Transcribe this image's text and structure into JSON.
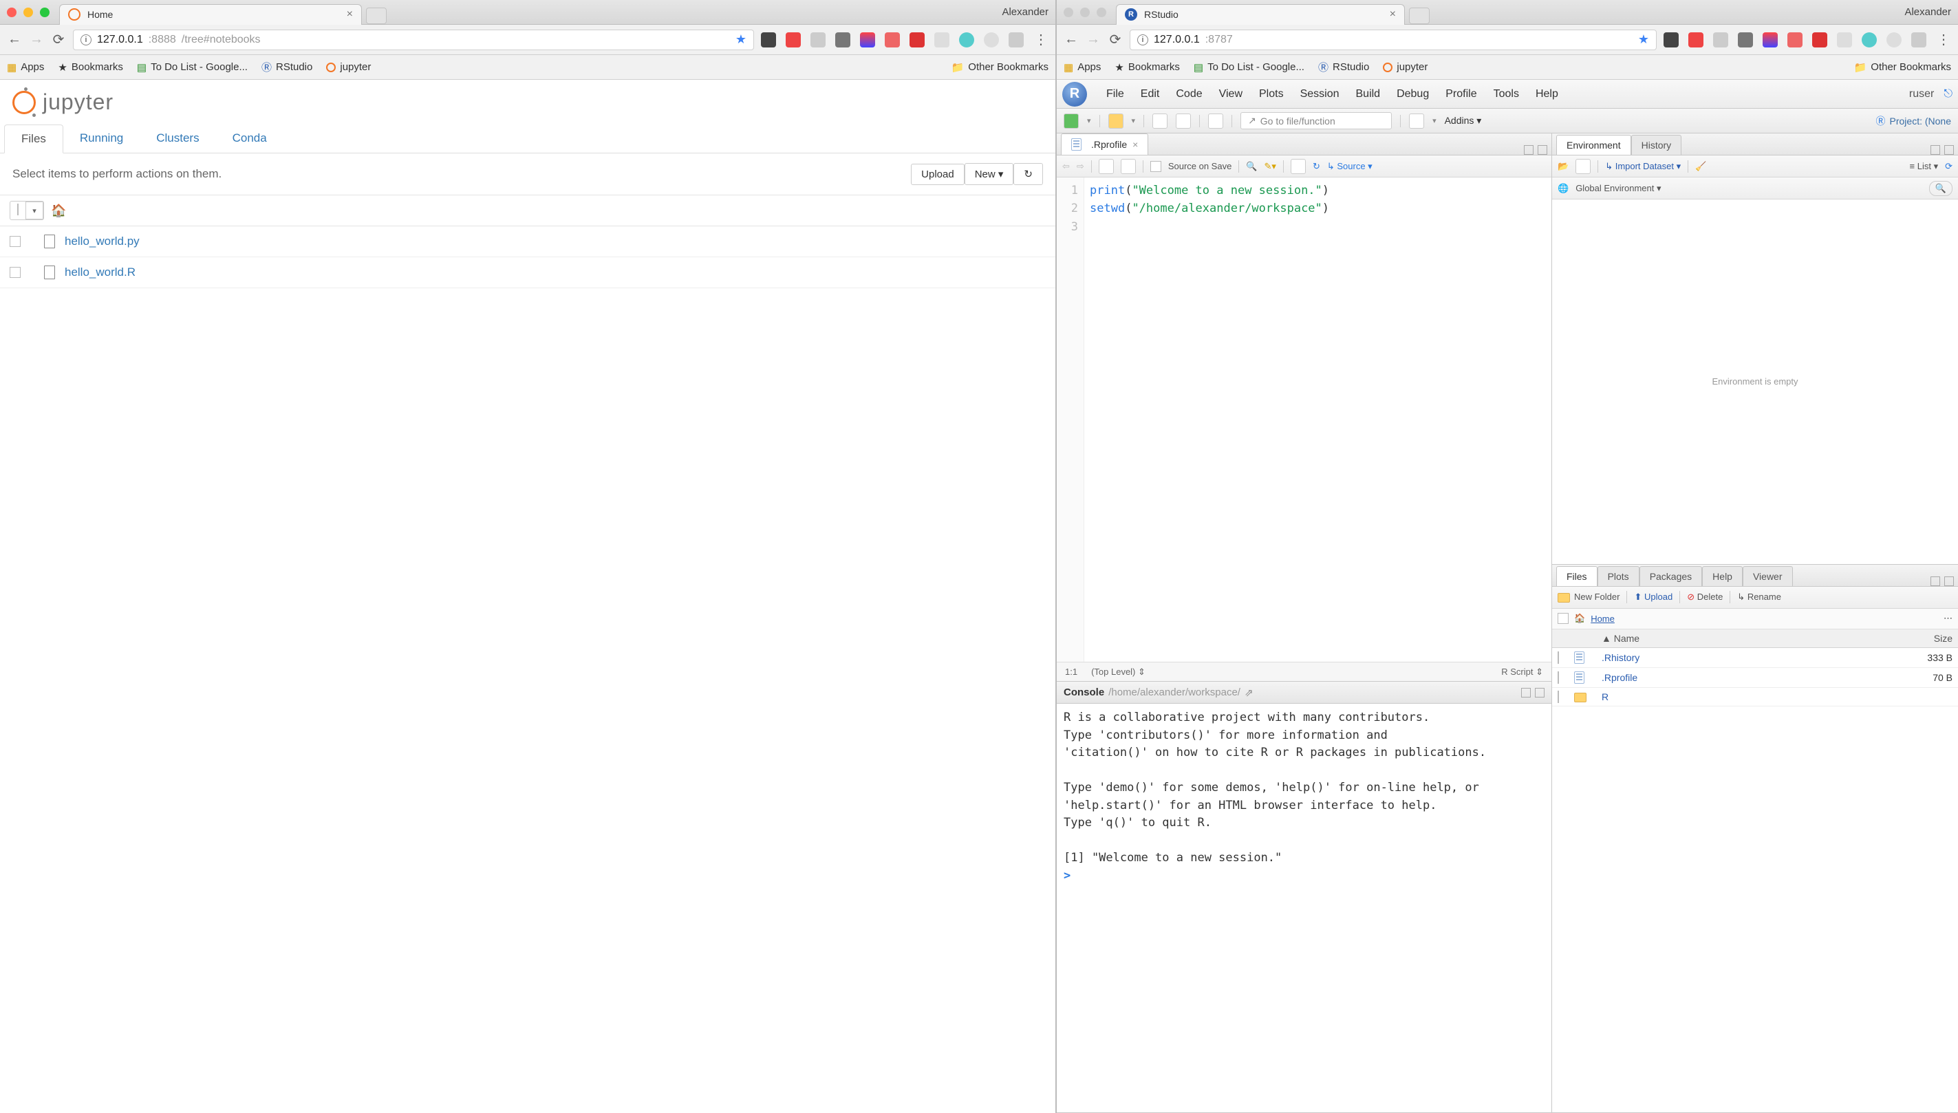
{
  "left": {
    "profile": "Alexander",
    "tab_title": "Home",
    "url_host": "127.0.0.1",
    "url_port": ":8888",
    "url_path": "/tree#notebooks",
    "bookmarks": {
      "apps": "Apps",
      "bm": "Bookmarks",
      "todo": "To Do List - Google...",
      "rstudio": "RStudio",
      "jupyter": "jupyter",
      "other": "Other Bookmarks"
    },
    "logo": "jupyter",
    "tabs": [
      "Files",
      "Running",
      "Clusters",
      "Conda"
    ],
    "hint": "Select items to perform actions on them.",
    "buttons": {
      "upload": "Upload",
      "new": "New",
      "refresh": "↻"
    },
    "files": [
      {
        "name": "hello_world.py"
      },
      {
        "name": "hello_world.R"
      }
    ]
  },
  "right": {
    "profile": "Alexander",
    "tab_title": "RStudio",
    "url_host": "127.0.0.1",
    "url_port": ":8787",
    "bookmarks": {
      "apps": "Apps",
      "bm": "Bookmarks",
      "todo": "To Do List - Google...",
      "rstudio": "RStudio",
      "jupyter": "jupyter",
      "other": "Other Bookmarks"
    },
    "menu": [
      "File",
      "Edit",
      "Code",
      "View",
      "Plots",
      "Session",
      "Build",
      "Debug",
      "Profile",
      "Tools",
      "Help"
    ],
    "user": "ruser",
    "goto_placeholder": "Go to file/function",
    "addins": "Addins",
    "project": "Project: (None",
    "source": {
      "tab": ".Rprofile",
      "on_save": "Source on Save",
      "source_btn": "Source",
      "lines": [
        "print(\"Welcome to a new session.\")",
        "setwd(\"/home/alexander/workspace\")",
        ""
      ],
      "status_pos": "1:1",
      "status_scope": "(Top Level)",
      "status_type": "R Script"
    },
    "console": {
      "title": "Console",
      "path": "/home/alexander/workspace/",
      "text": "R is a collaborative project with many contributors.\nType 'contributors()' for more information and\n'citation()' on how to cite R or R packages in publications.\n\nType 'demo()' for some demos, 'help()' for on-line help, or\n'help.start()' for an HTML browser interface to help.\nType 'q()' to quit R.\n\n[1] \"Welcome to a new session.\"",
      "prompt": ">"
    },
    "env": {
      "tabs": [
        "Environment",
        "History"
      ],
      "import": "Import Dataset",
      "list": "List",
      "scope": "Global Environment",
      "empty": "Environment is empty"
    },
    "files_pane": {
      "tabs": [
        "Files",
        "Plots",
        "Packages",
        "Help",
        "Viewer"
      ],
      "buttons": {
        "new_folder": "New Folder",
        "upload": "Upload",
        "delete": "Delete",
        "rename": "Rename"
      },
      "crumb": "Home",
      "cols": {
        "name": "Name",
        "size": "Size"
      },
      "rows": [
        {
          "name": ".Rhistory",
          "size": "333 B",
          "type": "doc"
        },
        {
          "name": ".Rprofile",
          "size": "70 B",
          "type": "doc"
        },
        {
          "name": "R",
          "size": "",
          "type": "folder"
        }
      ]
    }
  }
}
